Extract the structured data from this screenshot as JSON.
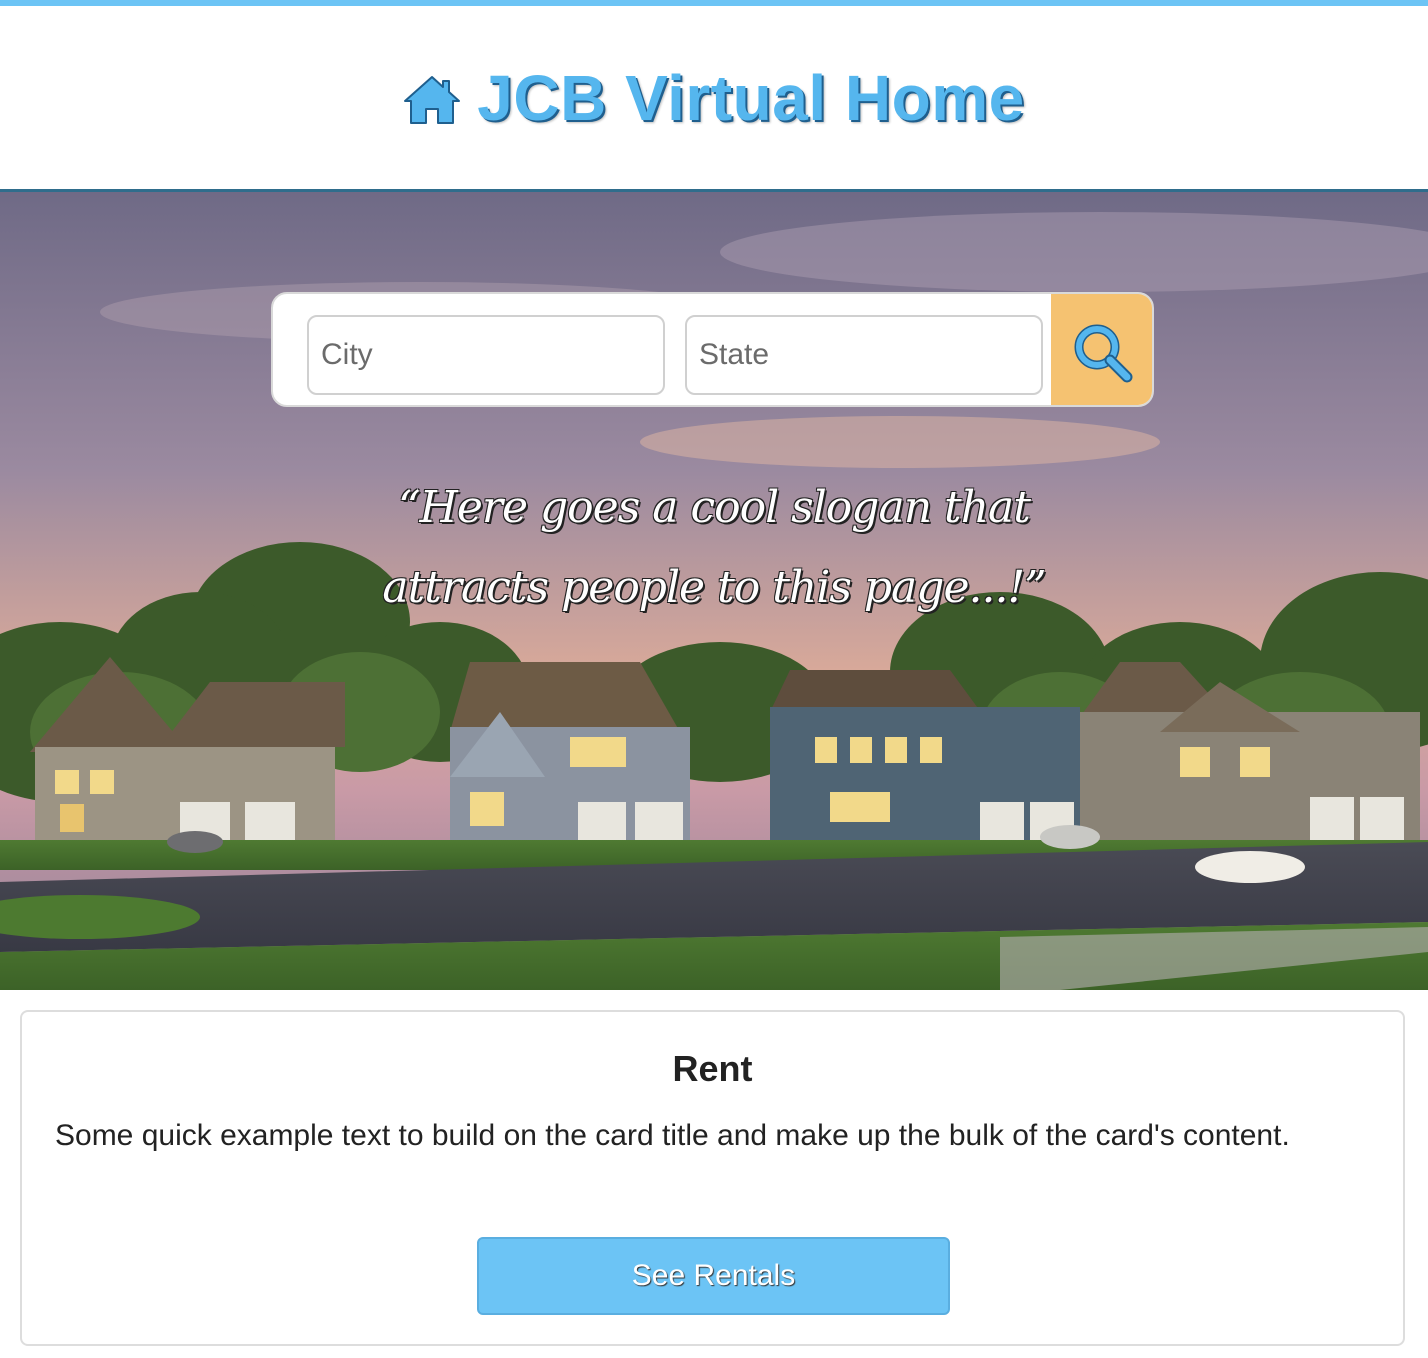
{
  "header": {
    "brand_icon": "home-icon",
    "title": "JCB Virtual Home",
    "accent_color": "#55b6ee"
  },
  "search": {
    "city_placeholder": "City",
    "city_value": "",
    "state_placeholder": "State",
    "state_value": "",
    "button_icon": "search-icon",
    "button_color": "#f5c271"
  },
  "hero": {
    "slogan_line1": "“Here goes a cool slogan that",
    "slogan_line2": "attracts people to this page...!”"
  },
  "card": {
    "title": "Rent",
    "text": "Some quick example text to build on the card title and make up the bulk of the card's content.",
    "button_label": "See Rentals",
    "button_color": "#6cc4f5"
  }
}
